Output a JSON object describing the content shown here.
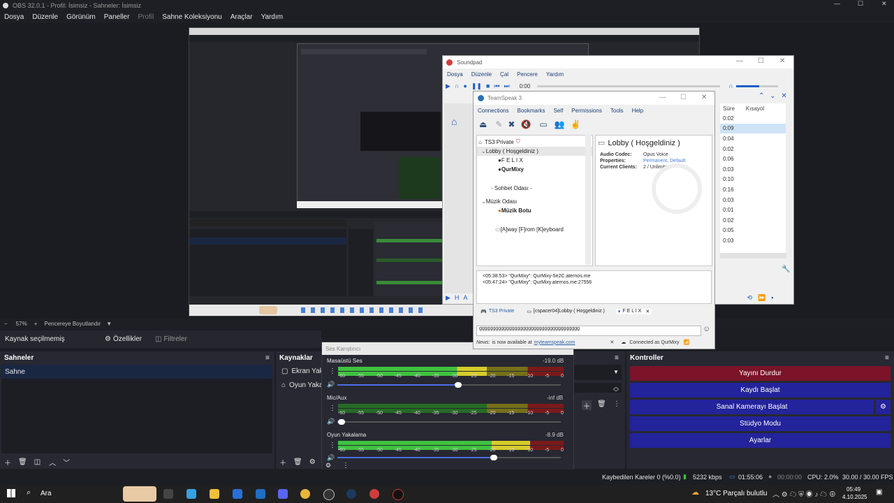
{
  "obs": {
    "title": "OBS 32.0.1 - Profil: İsimsiz - Sahneler: İsimsiz",
    "menu": [
      "Dosya",
      "Düzenle",
      "Görünüm",
      "Paneller",
      "Profil",
      "Sahne Koleksiyonu",
      "Araçlar",
      "Yardım"
    ],
    "zoom": "57%",
    "zoom_minus": "−",
    "zoom_plus": "+",
    "fit_label": "Pencereye Boyutlandır",
    "no_source": "Kaynak seçilmemiş",
    "properties": "Özellikler",
    "filters": "Filtreler",
    "scenes_title": "Sahneler",
    "scene_item": "Sahne",
    "sources_title": "Kaynaklar",
    "sources": [
      "Ekran Yaka",
      "Oyun Yaka"
    ],
    "controls_title": "Kontroller",
    "controls": {
      "stop_stream": "Yayını Durdur",
      "start_record": "Kaydı Başlat",
      "start_virtualcam": "Sanal Kamerayı Başlat",
      "studio_mode": "Stüdyo Modu",
      "settings": "Ayarlar"
    },
    "colors": {
      "stream_active": "#7c1328",
      "control_blue": "#23239b",
      "scene_selected": "#1a2742"
    }
  },
  "mixer": {
    "title": "Ses Karıştırıcı",
    "ticks": [
      "-60",
      "-55",
      "-50",
      "-45",
      "-40",
      "-35",
      "-30",
      "-25",
      "-20",
      "-15",
      "-10",
      "-5",
      "0"
    ],
    "channels": [
      {
        "name": "Masaüstü Ses",
        "db": "-19.0 dB",
        "level": 0.66,
        "volume": 0.54
      },
      {
        "name": "Mic/Aux",
        "db": "-inf dB",
        "level": 0.0,
        "volume": 0.02
      },
      {
        "name": "Oyun Yakalama",
        "db": "-8.9 dB",
        "level": 0.85,
        "volume": 0.7
      }
    ]
  },
  "status": {
    "dropped": "Kaybedilen Kareler 0 (%0.0)",
    "bitrate": "5232 kbps",
    "stream_time": "01:55:06",
    "rec_time": "00:00:00",
    "cpu": "CPU: 2.0%",
    "fps": "30.00 / 30.00 FPS"
  },
  "soundpad": {
    "title": "Soundpad",
    "menu": [
      "Dosya",
      "Düzenle",
      "Çal",
      "Pencere",
      "Yardım"
    ],
    "time": "0:00",
    "col_duration": "Süre",
    "col_shortcut": "Kısayol",
    "durations": [
      "0:02",
      "0:09",
      "0:04",
      "0:02",
      "0:06",
      "0:03",
      "0:10",
      "0:16",
      "0:03",
      "0:01",
      "0:02",
      "0:05",
      "0:03"
    ]
  },
  "teamspeak": {
    "title": "TeamSpeak 3",
    "menu": [
      "Connections",
      "Bookmarks",
      "Self",
      "Permissions",
      "Tools",
      "Help"
    ],
    "server": "TS3 Private",
    "tree": [
      {
        "label": "Lobby ( Hoşgeldiniz )",
        "type": "channel"
      },
      {
        "label": "F E L I X",
        "type": "user"
      },
      {
        "label": "QurMixy",
        "type": "user"
      },
      {
        "label": "- Sohbet Odası -",
        "type": "spacer"
      },
      {
        "label": "Müzik Odası",
        "type": "channel"
      },
      {
        "label": "Müzik Botu",
        "type": "user"
      },
      {
        "label": "[A]way [F]rom [K]eyboard",
        "type": "channel"
      }
    ],
    "info_title": "Lobby ( Hoşgeldiniz )",
    "info": [
      {
        "key": "Audio Codec:",
        "value": "Opus Voice"
      },
      {
        "key": "Properties:",
        "value": "Permanent, Default"
      },
      {
        "key": "Current Clients:",
        "value": "2 / Unlimited"
      }
    ],
    "log": [
      "<05:38:53> \"QurMixy\": QurMixy-5e2C.aternos.me",
      "<05:47:24> \"QurMixy\": QurMixy.aternos.me:27556"
    ],
    "tabs": [
      "TS3 Private",
      "[cspacer04]Lobby ( Hoşgeldiniz )",
      "F E L I X"
    ],
    "chat_input": "ggggggggggggggggggggggggggggggggggggg",
    "news_label": "News:",
    "news_text": "is now available at",
    "news_link": "myteamspeak.com",
    "connected": "Connected as QurMixy"
  },
  "taskbar": {
    "search": "Ara",
    "weather": "13°C  Parçalı bulutlu",
    "time": "05:49",
    "date": "4.10.2025"
  }
}
